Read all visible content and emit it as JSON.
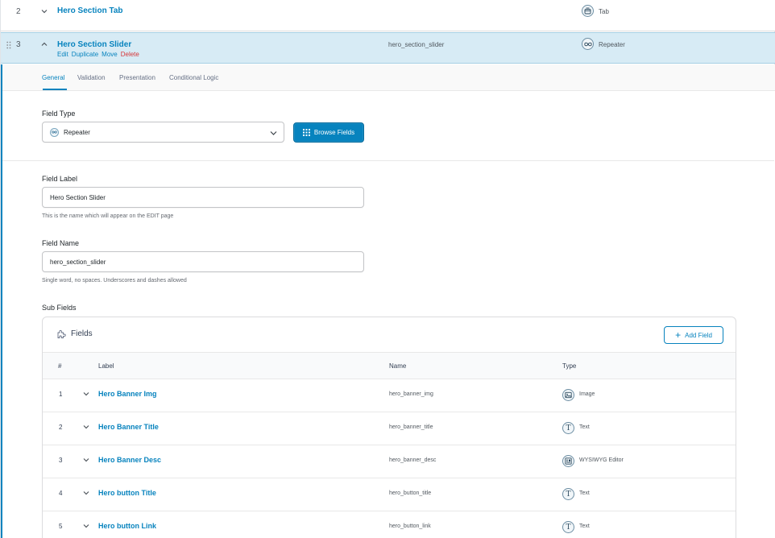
{
  "rows": {
    "row2": {
      "number": "2",
      "title": "Hero Section Tab",
      "type": "Tab",
      "type_icon": "tab-icon"
    },
    "row3": {
      "number": "3",
      "title": "Hero Section Slider",
      "name": "hero_section_slider",
      "type": "Repeater",
      "type_icon": "repeater-icon",
      "actions": {
        "edit": "Edit",
        "duplicate": "Duplicate",
        "move": "Move",
        "delete": "Delete"
      }
    }
  },
  "tabs": [
    "General",
    "Validation",
    "Presentation",
    "Conditional Logic"
  ],
  "field_type": {
    "label": "Field Type",
    "value": "Repeater",
    "browse_label": "Browse Fields"
  },
  "field_label": {
    "label": "Field Label",
    "value": "Hero Section Slider",
    "hint": "This is the name which will appear on the EDIT page"
  },
  "field_name": {
    "label": "Field Name",
    "value": "hero_section_slider",
    "hint": "Single word, no spaces. Underscores and dashes allowed"
  },
  "sub_fields": {
    "label": "Sub Fields",
    "box_title": "Fields",
    "add_label": "Add Field",
    "columns": {
      "num": "#",
      "label": "Label",
      "name": "Name",
      "type": "Type"
    },
    "items": [
      {
        "num": "1",
        "label": "Hero Banner Img",
        "name": "hero_banner_img",
        "type": "Image",
        "icon": "image-icon"
      },
      {
        "num": "2",
        "label": "Hero Banner Title",
        "name": "hero_banner_title",
        "type": "Text",
        "icon": "text-icon"
      },
      {
        "num": "3",
        "label": "Hero Banner Desc",
        "name": "hero_banner_desc",
        "type": "WYSIWYG Editor",
        "icon": "wysiwyg-icon"
      },
      {
        "num": "4",
        "label": "Hero button Title",
        "name": "hero_button_title",
        "type": "Text",
        "icon": "text-icon"
      },
      {
        "num": "5",
        "label": "Hero button Link",
        "name": "hero_button_link",
        "type": "Text",
        "icon": "text-icon"
      }
    ]
  },
  "colors": {
    "accent": "#0783be",
    "active_row": "#d7ebf5",
    "delete": "#d63638"
  }
}
